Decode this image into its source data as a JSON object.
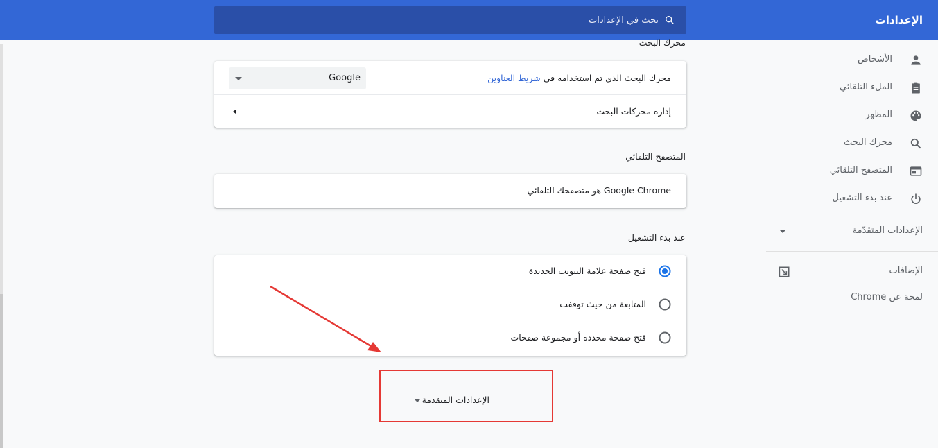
{
  "header": {
    "title": "الإعدادات",
    "search_placeholder": "بحث في الإعدادات",
    "search_icon": "search-icon"
  },
  "sidebar": {
    "items": [
      {
        "label": "الأشخاص",
        "icon": "person-icon"
      },
      {
        "label": "الملء التلقائي",
        "icon": "clipboard-icon"
      },
      {
        "label": "المظهر",
        "icon": "palette-icon"
      },
      {
        "label": "محرك البحث",
        "icon": "search-icon"
      },
      {
        "label": "المتصفح التلقائي",
        "icon": "browser-icon"
      },
      {
        "label": "عند بدء التشغيل",
        "icon": "power-icon"
      }
    ],
    "advanced_label": "الإعدادات المتقدّمة",
    "extensions_label": "الإضافات",
    "about_label": "لمحة عن Chrome"
  },
  "search_engine": {
    "title": "محرك البحث",
    "row_prefix": "محرك البحث الذي تم استخدامه في",
    "row_link": "شريط العناوين",
    "selected_engine": "Google",
    "manage_label": "إدارة محركات البحث"
  },
  "default_browser": {
    "title": "المتصفح التلقائي",
    "status_text": "Google Chrome هو متصفحك التلقائي"
  },
  "on_startup": {
    "title": "عند بدء التشغيل",
    "options": [
      {
        "label": "فتح صفحة علامة التبويب الجديدة",
        "checked": true
      },
      {
        "label": "المتابعة من حيث توقفت",
        "checked": false
      },
      {
        "label": "فتح صفحة محددة أو مجموعة صفحات",
        "checked": false
      }
    ]
  },
  "advanced_toggle": {
    "label": "الإعدادات المتقدمة"
  },
  "colors": {
    "header_blue": "#3367d6",
    "search_bg": "#2a4fa8",
    "highlight_red": "#e53935",
    "radio_blue": "#1a73e8"
  }
}
